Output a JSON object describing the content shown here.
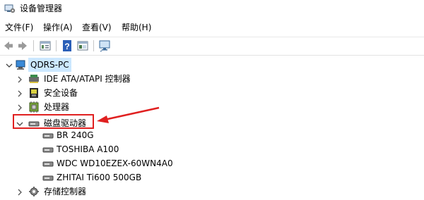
{
  "window": {
    "title": "设备管理器"
  },
  "menu": [
    "文件(F)",
    "操作(A)",
    "查看(V)",
    "帮助(H)"
  ],
  "toolbar": {
    "buttons": [
      "back-arrow-icon",
      "forward-arrow-icon",
      "properties-icon",
      "help-icon",
      "view-icon",
      "monitor-icon"
    ]
  },
  "tree": {
    "root": {
      "label": "QDRS-PC",
      "expanded": true
    },
    "categories": [
      {
        "label": "IDE ATA/ATAPI 控制器",
        "expanded": false,
        "icon": "ide-controller-icon"
      },
      {
        "label": "安全设备",
        "expanded": false,
        "icon": "security-device-icon"
      },
      {
        "label": "处理器",
        "expanded": false,
        "icon": "processor-icon"
      },
      {
        "label": "磁盘驱动器",
        "expanded": true,
        "icon": "disk-drive-icon",
        "children": [
          {
            "label": "BR 240G"
          },
          {
            "label": "TOSHIBA A100"
          },
          {
            "label": "WDC WD10EZEX-60WN4A0"
          },
          {
            "label": "ZHITAI Ti600 500GB"
          }
        ]
      },
      {
        "label": "存储控制器",
        "expanded": false,
        "icon": "storage-controller-icon"
      }
    ]
  },
  "annotation": {
    "color": "#e02020",
    "target": "磁盘驱动器"
  },
  "colors": {
    "selection": "#cce8ff",
    "help_blue": "#2b5fb8"
  }
}
